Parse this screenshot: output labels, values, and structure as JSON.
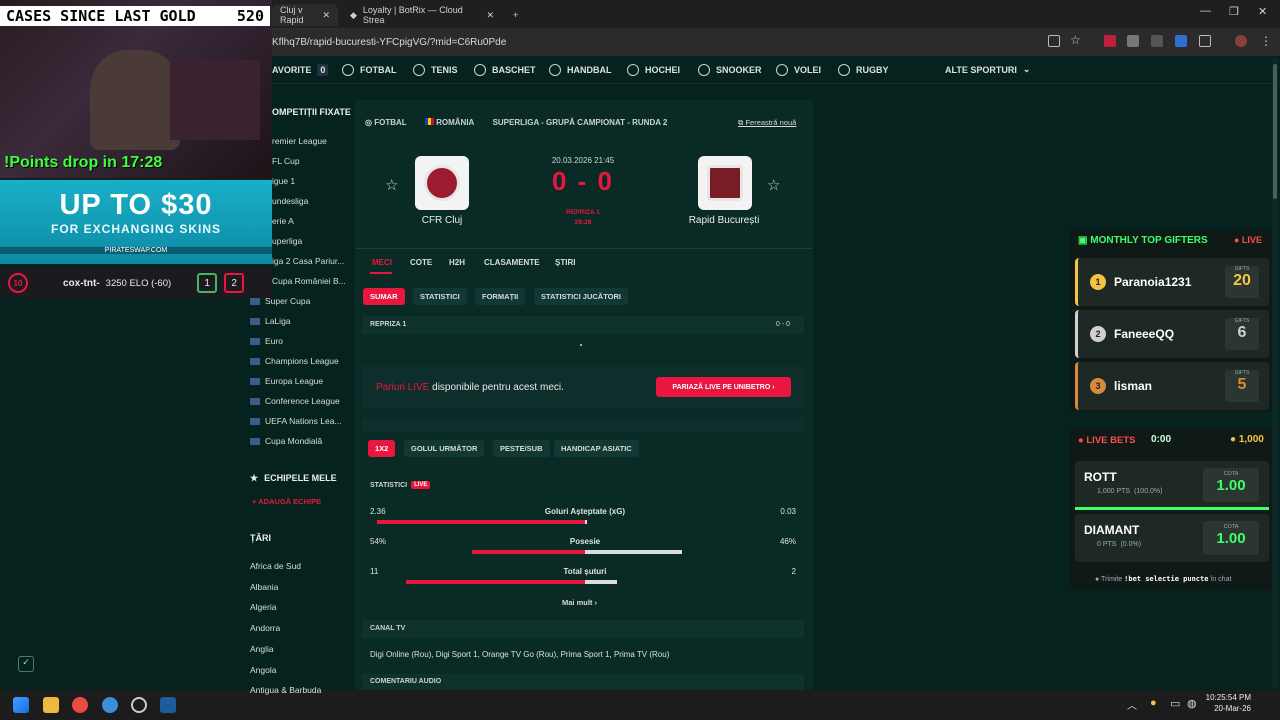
{
  "browser": {
    "tabs": [
      {
        "label": "Cluj v Rapid"
      },
      {
        "label": "Loyalty | BotRix — Cloud Strea"
      }
    ],
    "url": "Kflhq7B/rapid-bucuresti-YFCpigVG/?mid=C6Ru0Pde",
    "new_tab": "+",
    "win_controls": [
      "—",
      "❐",
      "✕"
    ]
  },
  "sports_nav": {
    "items": [
      {
        "label": "AVORITE",
        "badge": "0"
      },
      {
        "label": "FOTBAL",
        "icon": "football-icon"
      },
      {
        "label": "TENIS"
      },
      {
        "label": "BASCHET"
      },
      {
        "label": "HANDBAL"
      },
      {
        "label": "HOCHEI"
      },
      {
        "label": "SNOOKER"
      },
      {
        "label": "VOLEI"
      },
      {
        "label": "RUGBY"
      }
    ],
    "more": "ALTE SPORTURI"
  },
  "left": {
    "competitions_title": "OMPETIȚII FIXATE",
    "competitions": [
      "remier League",
      "FL Cup",
      "igue 1",
      "undesliga",
      "erie A",
      "uperliga",
      "iga 2 Casa Pariur...",
      "Cupa României B...",
      "Super Cupa",
      "LaLiga",
      "Euro",
      "Champions League",
      "Europa League",
      "Conference League",
      "UEFA Nations Lea...",
      "Cupa Mondială"
    ],
    "my_teams_title": "ECHIPELE MELE",
    "add_team": "+ ADAUGĂ ECHIPE",
    "countries_title": "ȚĂRI",
    "countries": [
      "Africa de Sud",
      "Albania",
      "Algeria",
      "Andorra",
      "Anglia",
      "Angola",
      "Antigua & Barbuda"
    ]
  },
  "match": {
    "breadcrumb": {
      "sport": "FOTBAL",
      "country": "ROMÂNIA",
      "competition": "SUPERLIGA - GRUPĂ CAMPIONAT - RUNDA 2"
    },
    "new_window": "Fereastră nouă",
    "datetime": "20.03.2026 21:45",
    "score": "0 - 0",
    "period": "REPRIZA 1",
    "minute": "29:28",
    "home": "CFR Cluj",
    "away": "Rapid București",
    "tabs": [
      "MECI",
      "COTE",
      "H2H",
      "CLASAMENTE",
      "ȘTIRI"
    ],
    "subtabs": [
      "SUMAR",
      "STATISTICI",
      "FORMAȚII",
      "STATISTICI JUCĂTORI"
    ],
    "half_label": "REPRIZA 1",
    "half_score": "0 - 0",
    "live_bet_text_red": "Pariuri LIVE",
    "live_bet_text": "disponibile pentru acest meci.",
    "live_bet_button": "PARIAZĂ LIVE PE UNIBETRO  ›",
    "bet_tabs": [
      "1X2",
      "GOLUL URMĂTOR",
      "PESTE/SUB",
      "HANDICAP ASIATIC"
    ],
    "stats_title": "STATISTICI",
    "live_badge": "LIVE",
    "stats": [
      {
        "label": "Goluri Așteptate (xG)",
        "home": "2.36",
        "away": "0.03",
        "home_frac": 0.99,
        "away_frac": 0.01
      },
      {
        "label": "Posesie",
        "home": "54%",
        "away": "46%",
        "home_frac": 0.54,
        "away_frac": 0.46
      },
      {
        "label": "Total șuturi",
        "home": "11",
        "away": "2",
        "home_frac": 0.85,
        "away_frac": 0.15
      }
    ],
    "more": "Mai mult  ›",
    "tv_title": "CANAL TV",
    "tv": "Digi Online (Rou),  Digi Sport 1,  Orange TV Go (Rou),  Prima Sport 1,  Prima TV (Rou)",
    "audio_title": "COMENTARIU AUDIO"
  },
  "stream": {
    "cases_label": "CASES SINCE LAST GOLD",
    "cases_value": "520",
    "points_drop": "!Points drop in 17:28",
    "promo_line1": "UP TO $30",
    "promo_line2": "FOR EXCHANGING SKINS",
    "promo_site": "PIRATESWAP.COM",
    "level": "10",
    "player": "cox-tnt-",
    "elo": "3250 ELO (-60)",
    "score_a": "1",
    "score_b": "2"
  },
  "gifters": {
    "title": "MONTHLY TOP GIFTERS",
    "live": "● LIVE",
    "gifts_label": "GIFTS",
    "list": [
      {
        "rank": "1",
        "name": "Paranoia1231",
        "gifts": "20",
        "color": "#f5c542"
      },
      {
        "rank": "2",
        "name": "FaneeeQQ",
        "gifts": "6",
        "color": "#d0d0d0"
      },
      {
        "rank": "3",
        "name": "lisman",
        "gifts": "5",
        "color": "#d68a3a"
      }
    ]
  },
  "bets": {
    "title": "● LIVE BETS",
    "timer": "0:00",
    "pool": "1,000",
    "cota_label": "COTA",
    "options": [
      {
        "name": "ROTT",
        "pts": "1,000 PTS",
        "pct": "(100.0%)",
        "cota": "1.00"
      },
      {
        "name": "DIAMANT",
        "pts": "0 PTS",
        "pct": "(0.0%)",
        "cota": "1.00"
      }
    ],
    "footer_pre": "Trimite",
    "footer_cmd": "!bet selectie puncte",
    "footer_post": "în chat"
  },
  "taskbar": {
    "time": "10:25:54 PM",
    "date": "20-Mar-26"
  }
}
